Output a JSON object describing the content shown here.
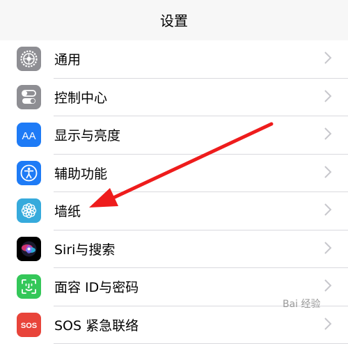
{
  "header": {
    "title": "设置"
  },
  "rows": [
    {
      "label": "通用",
      "icon": "gear-icon",
      "color": "#8e8e93"
    },
    {
      "label": "控制中心",
      "icon": "toggle-switches-icon",
      "color": "#8e8e93"
    },
    {
      "label": "显示与亮度",
      "icon": "aa-text-icon",
      "color": "#1e7bf6"
    },
    {
      "label": "辅助功能",
      "icon": "accessibility-icon",
      "color": "#1e7bf6"
    },
    {
      "label": "墙纸",
      "icon": "flower-icon",
      "color": "#36aadc"
    },
    {
      "label": "Siri与搜索",
      "icon": "siri-icon",
      "color": "#000000"
    },
    {
      "label": "面容 ID与密码",
      "icon": "face-id-icon",
      "color": "#34c759"
    },
    {
      "label": "SOS 紧急联络",
      "icon": "sos-icon",
      "color": "#e8443a",
      "icon_text": "SOS"
    }
  ],
  "annotation": {
    "color": "#ee1c1c"
  }
}
